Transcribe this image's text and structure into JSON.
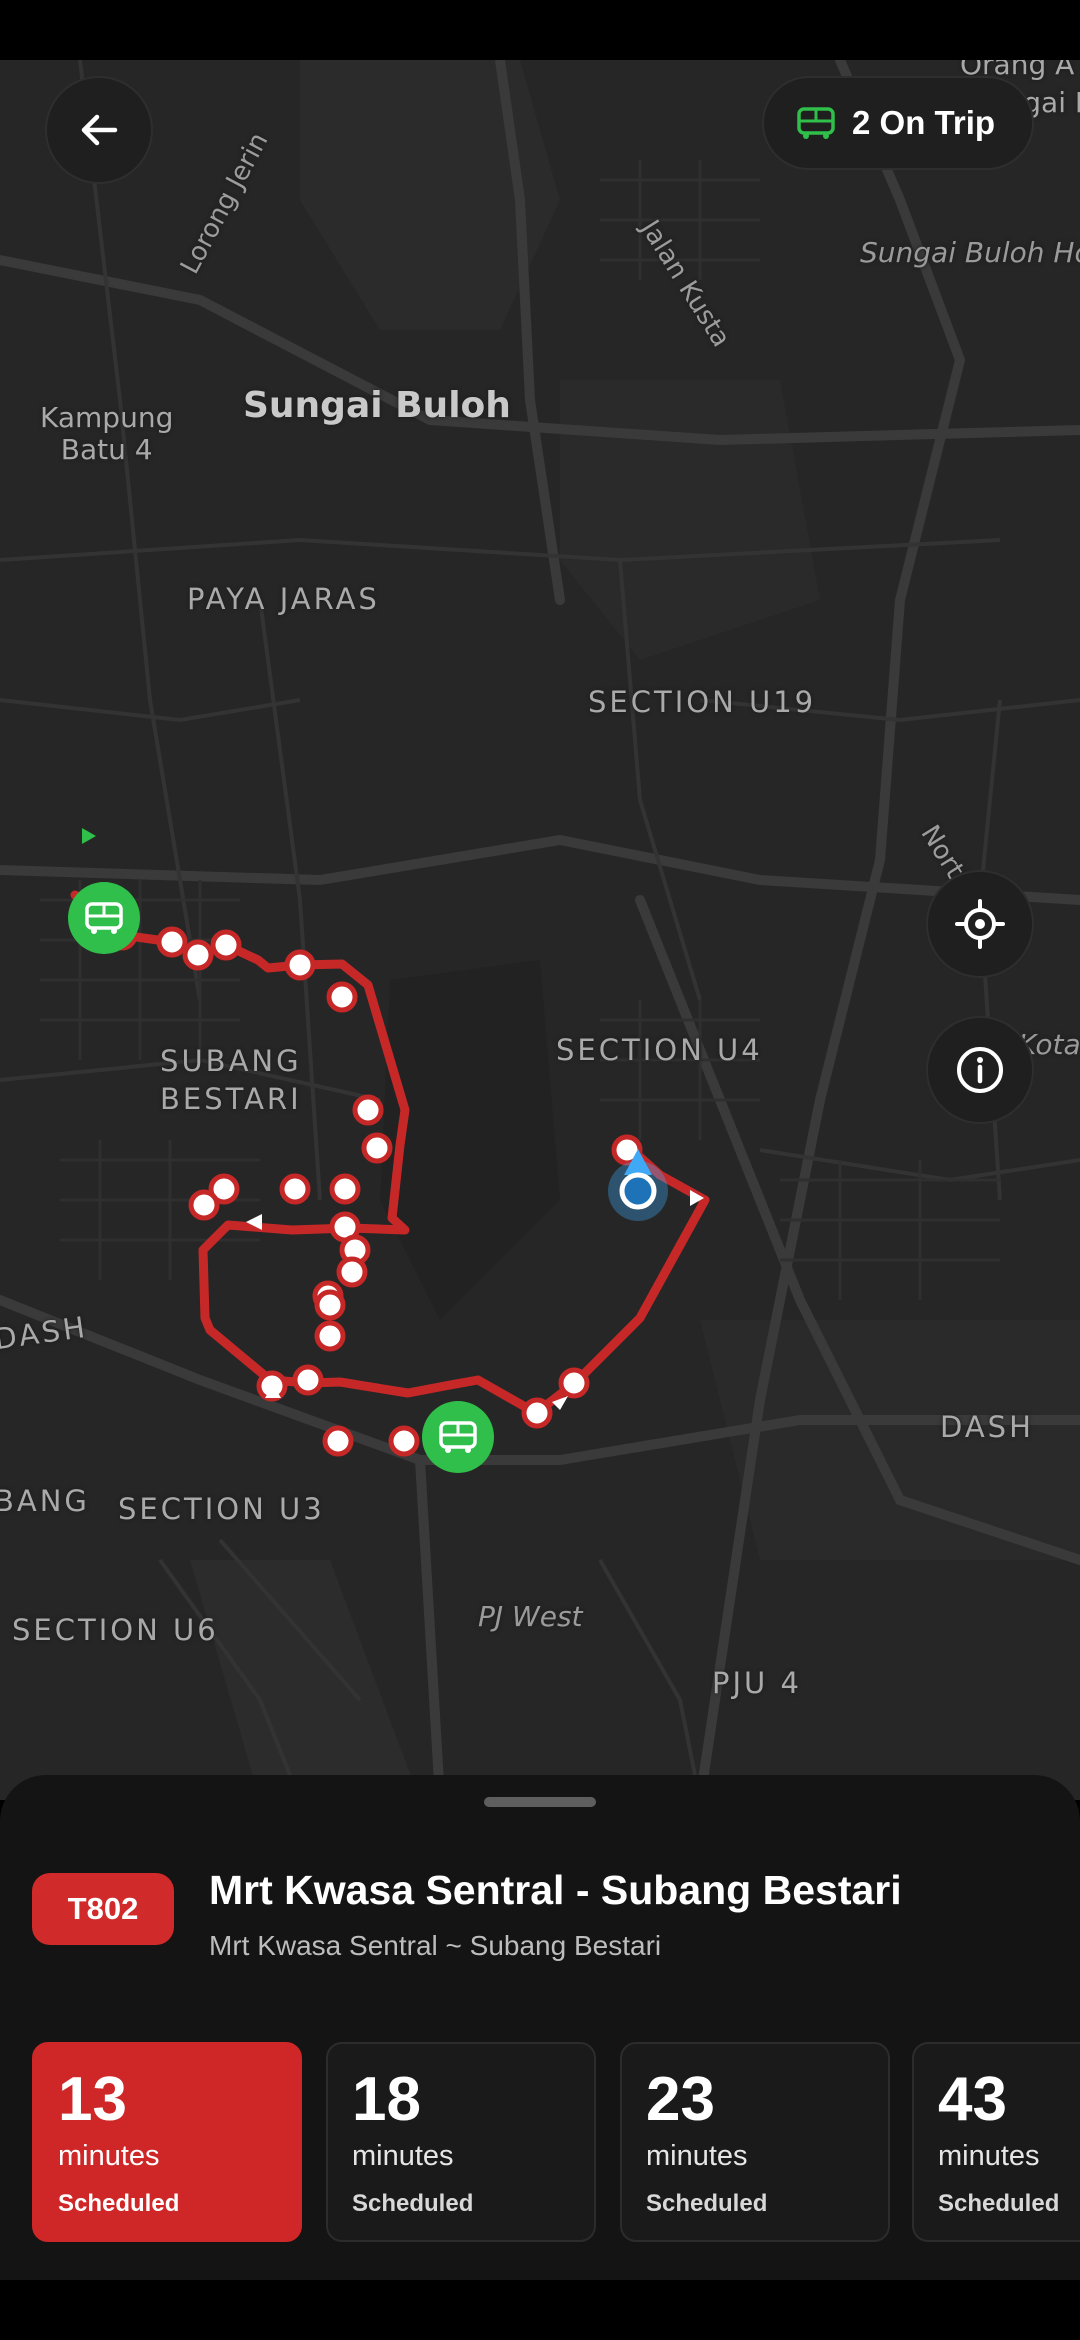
{
  "header": {
    "back_icon": "arrow-left-icon",
    "trip_icon": "bus-icon",
    "on_trip_label": "2 On Trip"
  },
  "map": {
    "labels": {
      "kampung_batu": "Kampung\nBatu 4",
      "sungai_buloh": "Sungai Buloh",
      "sungai_buloh_ho": "Sungai Buloh Ho",
      "orang_a": "Orang A",
      "sungai_b": "Sungai B",
      "paya_jaras": "PAYA JARAS",
      "section_u19": "SECTION U19",
      "north_south": "North-South",
      "subang_bestari": "SUBANG\nBESTARI",
      "section_u4": "SECTION U4",
      "kota": "Kota",
      "dash_left": "DASH",
      "dash_right": "DASH",
      "bang": "BANG",
      "section_u3": "SECTION U3",
      "section_u6": "SECTION U6",
      "pj_west": "PJ West",
      "pju_4": "PJU 4",
      "lorong_jerin": "Lorong Jerin",
      "jalan_kusta": "Jalan Kusta"
    },
    "controls": {
      "locate_icon": "crosshair-icon",
      "info_icon": "info-icon"
    },
    "colors": {
      "route": "#c62828",
      "bus_marker": "#2fbf4a",
      "user_location": "#3fa9f5"
    }
  },
  "route": {
    "code": "T802",
    "title": "Mrt Kwasa Sentral - Subang Bestari",
    "subtitle": "Mrt Kwasa Sentral ~ Subang Bestari"
  },
  "schedule": [
    {
      "minutes": "13",
      "unit": "minutes",
      "status": "Scheduled",
      "active": true
    },
    {
      "minutes": "18",
      "unit": "minutes",
      "status": "Scheduled",
      "active": false
    },
    {
      "minutes": "23",
      "unit": "minutes",
      "status": "Scheduled",
      "active": false
    },
    {
      "minutes": "43",
      "unit": "minutes",
      "status": "Scheduled",
      "active": false
    }
  ]
}
